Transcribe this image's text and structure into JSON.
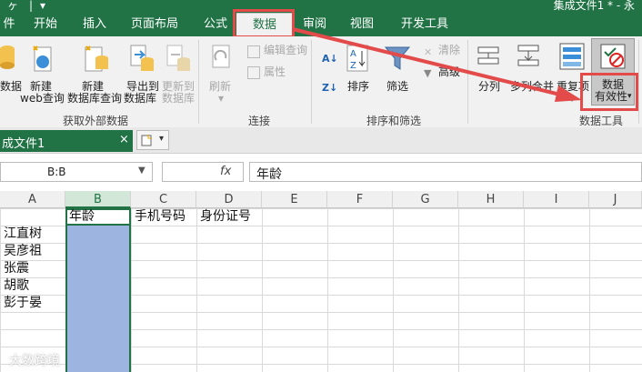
{
  "title_bar": {
    "quick_access": [
      "ヶ",
      "|",
      "▾"
    ],
    "title": "集成文件1 * - 永"
  },
  "tabs": [
    {
      "label": "件",
      "active": false
    },
    {
      "label": "开始",
      "active": false
    },
    {
      "label": "插入",
      "active": false
    },
    {
      "label": "页面布局",
      "active": false
    },
    {
      "label": "公式",
      "active": false
    },
    {
      "label": "数据",
      "active": true
    },
    {
      "label": "审阅",
      "active": false
    },
    {
      "label": "视图",
      "active": false
    },
    {
      "label": "开发工具",
      "active": false
    }
  ],
  "ribbon": {
    "get_external": {
      "group_label": "获取外部数据",
      "buttons": {
        "b0": "数据",
        "b1_l1": "新建",
        "b1_l2": "web查询",
        "b2_l1": "新建",
        "b2_l2": "数据库查询",
        "b3_l1": "导出到",
        "b3_l2": "数据库",
        "b4_l1": "更新到",
        "b4_l2": "数据库"
      }
    },
    "connections": {
      "group_label": "连接",
      "refresh": "刷新",
      "edit_query": "编辑查询",
      "properties": "属性"
    },
    "sort_filter": {
      "group_label": "排序和筛选",
      "sort": "排序",
      "filter": "筛选",
      "clear": "清除",
      "advanced": "高级"
    },
    "data_tools": {
      "group_label": "数据工具",
      "split": "分列",
      "merge": "多列合并",
      "duplicate": "重复项",
      "validation_l1": "数据",
      "validation_l2": "有效性"
    }
  },
  "workbook_tab": {
    "name": "成文件1",
    "close": "×"
  },
  "formula_bar": {
    "name_box": "B:B",
    "fx": "fx",
    "content": "年龄"
  },
  "columns": [
    "A",
    "B",
    "C",
    "D",
    "E",
    "F",
    "G",
    "H",
    "I",
    "J"
  ],
  "cells": {
    "b1": "年龄",
    "c1": "手机号码",
    "d1": "身份证号",
    "a2": "江直树",
    "a3": "吴彦祖",
    "a4": "张震",
    "a5": "胡歌",
    "a6": "彭于晏"
  },
  "watermark": "大数跨境",
  "colors": {
    "accent": "#217346",
    "highlight": "#e34b4b",
    "selection": "#9db3e0"
  }
}
